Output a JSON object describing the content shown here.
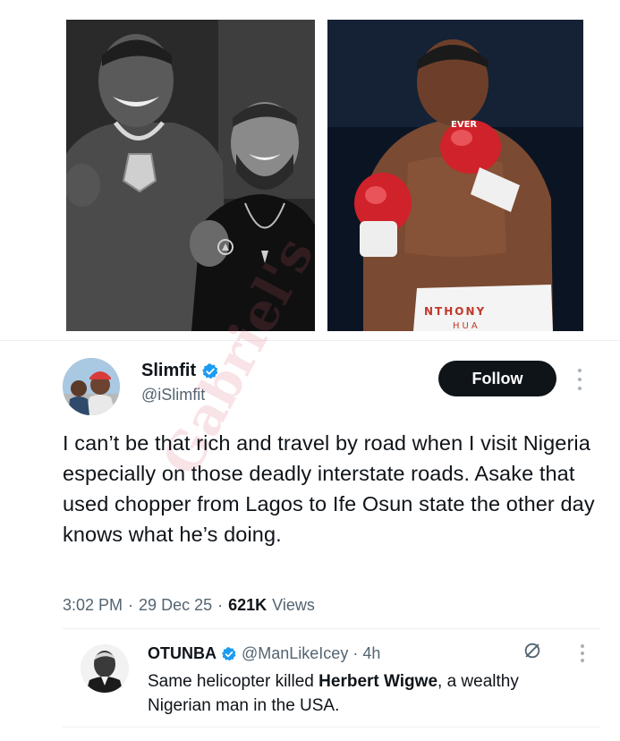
{
  "photos": {
    "left_alt": "",
    "right_trunks_text": "NTHONY",
    "right_trunks_subtext": "HUA",
    "right_glove_text": "EVER"
  },
  "watermark": {
    "text": "Gabriel's"
  },
  "tweet": {
    "author_name": "Slimfit",
    "author_handle": "@iSlimfit",
    "follow_label": "Follow",
    "text": "I can’t be that rich and travel by road when I visit Nigeria especially on those deadly interstate roads. Asake that used chopper from Lagos to Ife Osun state the other day knows what he’s doing.",
    "time": "3:02 PM",
    "sep1": "·",
    "date": "29 Dec 25",
    "sep2": "·",
    "views_count": "621K",
    "views_label": "Views",
    "verified_color": "#1d9bf0"
  },
  "reply": {
    "author_name": "OTUNBA",
    "author_handle": "@ManLikeIcey",
    "sep": "·",
    "time": "4h",
    "text_prefix": "Same helicopter killed ",
    "text_bold": "Herbert Wigwe",
    "text_suffix": ", a wealthy Nigerian man in the USA."
  },
  "icons": {
    "verified": "verified-badge-icon",
    "more": "more-vertical-icon",
    "grok": "slash-circle-icon"
  }
}
